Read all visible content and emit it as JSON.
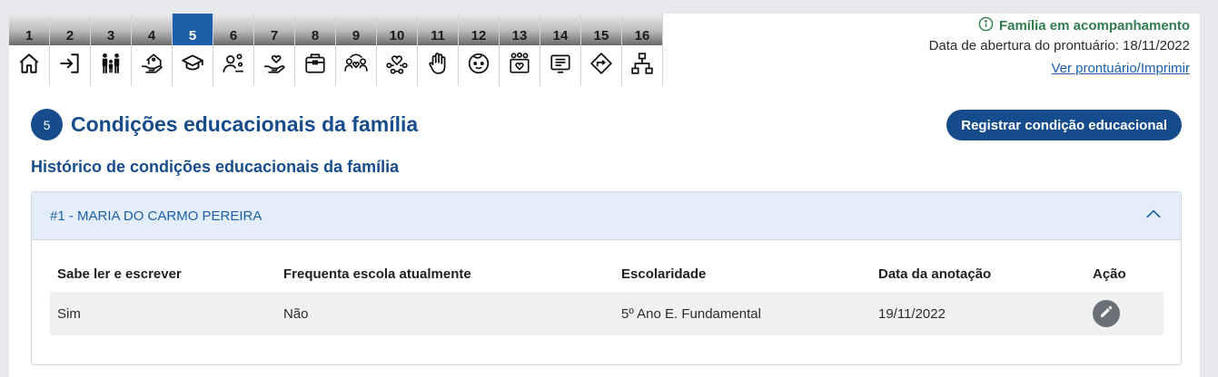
{
  "tabs": [
    {
      "number": "1",
      "icon": "home-icon"
    },
    {
      "number": "2",
      "icon": "login-icon"
    },
    {
      "number": "3",
      "icon": "family-icon"
    },
    {
      "number": "4",
      "icon": "house-hand-icon"
    },
    {
      "number": "5",
      "icon": "graduation-cap-icon",
      "active": true
    },
    {
      "number": "6",
      "icon": "person-settings-icon"
    },
    {
      "number": "7",
      "icon": "hand-heart-icon"
    },
    {
      "number": "8",
      "icon": "calendar-box-icon"
    },
    {
      "number": "9",
      "icon": "people-heart-icon"
    },
    {
      "number": "10",
      "icon": "network-heart-icon"
    },
    {
      "number": "11",
      "icon": "raised-hand-icon"
    },
    {
      "number": "12",
      "icon": "child-face-icon"
    },
    {
      "number": "13",
      "icon": "group-heart-icon"
    },
    {
      "number": "14",
      "icon": "document-list-icon"
    },
    {
      "number": "15",
      "icon": "direction-sign-icon"
    },
    {
      "number": "16",
      "icon": "org-chart-icon"
    }
  ],
  "header_info": {
    "status": "Família em acompanhamento",
    "opening_date": "Data de abertura do prontuário: 18/11/2022",
    "print_link": "Ver prontuário/Imprimir"
  },
  "section": {
    "number": "5",
    "title": "Condições educacionais da família",
    "action_button": "Registrar condição educacional",
    "subtitle": "Histórico de condições educacionais da família"
  },
  "accordion": {
    "title": "#1 - MARIA DO CARMO PEREIRA"
  },
  "table": {
    "headers": [
      "Sabe ler e escrever",
      "Frequenta escola atualmente",
      "Escolaridade",
      "Data da anotação",
      "Ação"
    ],
    "rows": [
      {
        "reads_writes": "Sim",
        "attends_school": "Não",
        "schooling": "5º Ano E. Fundamental",
        "date": "19/11/2022"
      }
    ]
  },
  "colors": {
    "primary": "#164c8c",
    "link": "#1d5fa8",
    "status_green": "#2f7d4a",
    "active_tab": "#1d5fa8"
  }
}
